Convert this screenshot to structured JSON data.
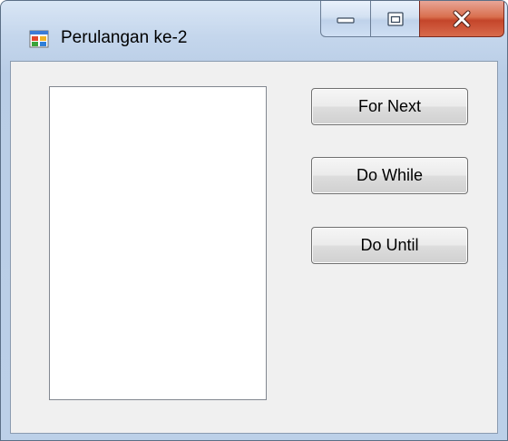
{
  "window": {
    "title": "Perulangan ke-2",
    "icon": "windows-form-icon"
  },
  "caption": {
    "minimize_icon": "minimize-icon",
    "maximize_icon": "maximize-icon",
    "close_icon": "close-icon"
  },
  "buttons": [
    {
      "label": "For Next"
    },
    {
      "label": "Do While"
    },
    {
      "label": "Do Until"
    }
  ],
  "listbox": {
    "items": []
  },
  "colors": {
    "close_button": "#c4452a",
    "client_background": "#f0f0f0"
  }
}
